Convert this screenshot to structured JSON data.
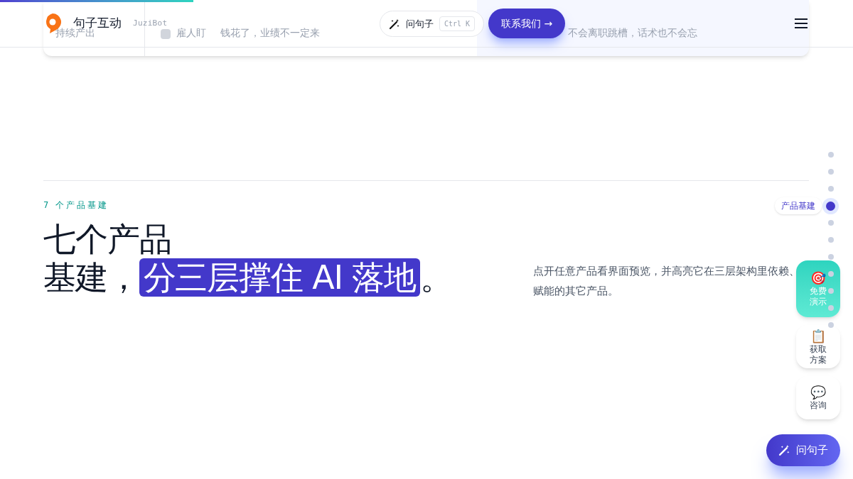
{
  "scroll_progress": {
    "level": 0.227
  },
  "background_card": {
    "cells": [
      {
        "text": "持续产出",
        "kind": "plain"
      },
      {
        "text": "雇人盯",
        "kind": "tag"
      },
      {
        "text": "钱花了，业绩不一定来",
        "kind": "plain"
      },
      {
        "text": "不会离职跳槽，话术也不会忘",
        "kind": "highlight"
      }
    ]
  },
  "header": {
    "brand": "句子互动",
    "brand_en": "JuziBot",
    "ask_button": {
      "label": "问句子",
      "shortcut": "Ctrl K"
    },
    "contact_button": "联系我们 →"
  },
  "section": {
    "eyebrow": "7 个产品基建",
    "title_line1": "七个产品",
    "title_line2_prefix": "基建，",
    "title_highlight": "分三层撑住 AI 落地",
    "title_suffix": "。",
    "description": "点开任意产品看界面预览，并高亮它在三层架构里依赖、赋能的其它产品。"
  },
  "section_nav": [
    {
      "selected": false
    },
    {
      "selected": false
    },
    {
      "selected": false
    },
    {
      "selected": true,
      "label": "产品基建"
    },
    {
      "selected": false
    },
    {
      "selected": false
    },
    {
      "selected": false
    },
    {
      "selected": false
    },
    {
      "selected": false
    },
    {
      "selected": false
    },
    {
      "selected": false
    }
  ],
  "float_actions": [
    {
      "kind": "demo",
      "icon": "🎯",
      "label": "免费演示"
    },
    {
      "kind": "plan",
      "icon": "📋",
      "label": "获取方案"
    },
    {
      "kind": "chat",
      "icon": "💬",
      "label": "咨询"
    }
  ],
  "ask_fab": "问句子"
}
